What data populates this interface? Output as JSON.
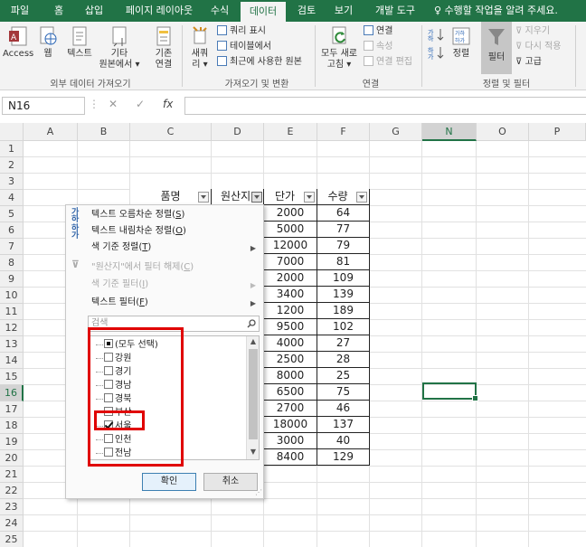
{
  "ribbon_tabs": [
    "파일",
    "홈",
    "삽입",
    "페이지 레이아웃",
    "수식",
    "데이터",
    "검토",
    "보기",
    "개발 도구"
  ],
  "active_tab": "데이터",
  "tell_me": "♀ 수행할 작업을 알려 주세요.",
  "groups": {
    "external": {
      "label": "외부 데이터 가져오기",
      "access": "Access",
      "web": "웹",
      "text": "텍스트",
      "other_1": "기타",
      "other_2": "원본에서 ▾",
      "existing_1": "기존",
      "existing_2": "연결"
    },
    "get_transform": {
      "label": "가져오기 및 변환",
      "new_query_1": "새쿼",
      "new_query_2": "리 ▾",
      "show_queries": "쿼리 표시",
      "from_table": "테이블에서",
      "recent_sources": "최근에 사용한 원본"
    },
    "connections": {
      "label": "연결",
      "refresh_1": "모두 새로",
      "refresh_2": "고침 ▾",
      "connections": "연결",
      "properties": "속성",
      "edit_links": "연결 편집"
    },
    "sort_filter": {
      "label": "정렬 및 필터",
      "sort": "정렬",
      "filter": "필터",
      "clear": "지우기",
      "reapply": "다시 적용",
      "advanced": "고급"
    }
  },
  "formula_bar": {
    "name_box": "N16",
    "cancel": "✕",
    "enter": "✓",
    "fx": "fx",
    "value": ""
  },
  "columns": [
    "A",
    "B",
    "C",
    "D",
    "E",
    "F",
    "G",
    "N",
    "O",
    "P"
  ],
  "selected_column": "N",
  "rows": [
    "1",
    "2",
    "3",
    "4",
    "5",
    "6",
    "7",
    "8",
    "9",
    "10",
    "11",
    "12",
    "13",
    "14",
    "15",
    "16",
    "17",
    "18",
    "19",
    "20",
    "21",
    "22",
    "23",
    "24",
    "25"
  ],
  "selected_row": "16",
  "table": {
    "headers": [
      "품명",
      "원산지",
      "단가",
      "수량"
    ],
    "unit_price": [
      "2000",
      "5000",
      "12000",
      "7000",
      "2000",
      "3400",
      "1200",
      "9500",
      "4000",
      "2500",
      "8000",
      "6500",
      "2700",
      "18000",
      "3000",
      "8400"
    ],
    "quantity": [
      "64",
      "77",
      "79",
      "81",
      "109",
      "139",
      "189",
      "102",
      "27",
      "28",
      "25",
      "75",
      "46",
      "137",
      "40",
      "129"
    ]
  },
  "filter_menu": {
    "sort_asc": "텍스트 오름차순 정렬",
    "sort_asc_key": "S",
    "sort_desc": "텍스트 내림차순 정렬",
    "sort_desc_key": "O",
    "sort_by_color": "색 기준 정렬",
    "sort_by_color_key": "T",
    "clear_filter": "\"원산지\"에서 필터 해제",
    "clear_filter_key": "C",
    "filter_by_color": "색 기준 필터",
    "filter_by_color_key": "I",
    "text_filters": "텍스트 필터",
    "text_filters_key": "F",
    "search_placeholder": "검색",
    "items": [
      {
        "label": "(모두 선택)",
        "state": "mixed"
      },
      {
        "label": "강원",
        "state": "off"
      },
      {
        "label": "경기",
        "state": "off"
      },
      {
        "label": "경남",
        "state": "off"
      },
      {
        "label": "경북",
        "state": "off"
      },
      {
        "label": "부산",
        "state": "off"
      },
      {
        "label": "서울",
        "state": "on"
      },
      {
        "label": "인천",
        "state": "off"
      },
      {
        "label": "전남",
        "state": "off"
      }
    ],
    "ok": "확인",
    "cancel": "취소"
  },
  "colors": {
    "excel_green": "#217346",
    "highlight_red": "#e00000"
  }
}
